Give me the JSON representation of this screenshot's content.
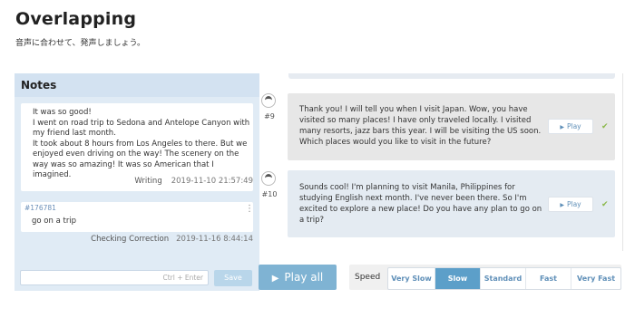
{
  "page": {
    "title": "Overlapping",
    "subtitle": "音声に合わせて、発声しましょう。"
  },
  "notes": {
    "title": "Notes",
    "note": {
      "text": "It was so good!\nI went on road trip to Sedona and Antelope Canyon with my friend last month.\nIt took about 8 hours from Los Angeles to there. But we enjoyed even driving on the way! The scenery on the way was so amazing! It was so American that I imagined.",
      "type": "Writing",
      "timestamp": "2019-11-10 21:57:49"
    },
    "correction": {
      "id": "#176781",
      "text": "go on a trip",
      "type": "Checking Correction",
      "timestamp": "2019-11-16 8:44:14"
    },
    "input_placeholder": "Ctrl + Enter",
    "save_label": "Save"
  },
  "messages": [
    {
      "number": "#9",
      "text": "Thank you! I will tell you when I visit Japan. Wow, you have visited so many places! I have only traveled locally. I visited many resorts, jazz bars this year. I will be visiting the US soon. Which places would you like to visit in the future?",
      "play_label": "Play",
      "checked": true
    },
    {
      "number": "#10",
      "text": "Sounds cool! I'm planning to visit Manila, Philippines for studying English next month. I've never been there. So I'm excited to explore a new place! Do you have any plan to go on a trip?",
      "play_label": "Play",
      "checked": true
    }
  ],
  "controls": {
    "play_all_label": "Play all",
    "speed_label": "Speed",
    "speed_options": [
      "Very Slow",
      "Slow",
      "Standard",
      "Fast",
      "Very Fast"
    ],
    "selected_speed": "Slow"
  },
  "icons": {
    "play": "play-icon",
    "check": "check-icon",
    "menu": "kebab-menu-icon",
    "avatar": "user-avatar-icon"
  },
  "colors": {
    "accent": "#5c9fc9",
    "play_all": "#7fb3d3",
    "check": "#8bb84a",
    "notes_bg": "#e0ebf5"
  }
}
